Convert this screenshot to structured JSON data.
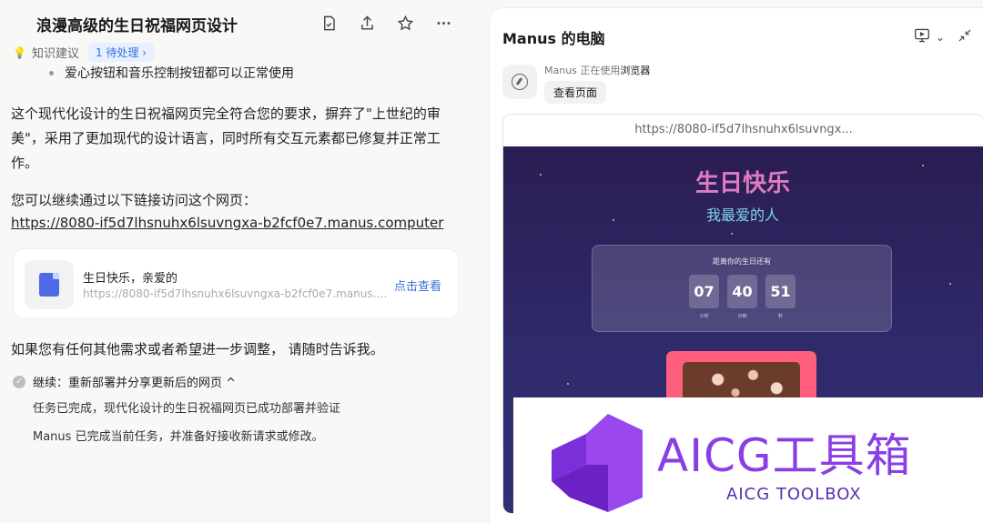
{
  "left": {
    "title": "浪漫高级的生日祝福网页设计",
    "knowledge": {
      "label": "知识建议",
      "badge": "1 待处理 ›"
    },
    "bullet": "爱心按钮和音乐控制按钮都可以正常使用",
    "para1": "这个现代化设计的生日祝福网页完全符合您的要求，摒弃了\"上世纪的审美\"，采用了更加现代的设计语言，同时所有交互元素都已修复并正常工作。",
    "para2": "您可以继续通过以下链接访问这个网页：",
    "link": "https://8080-if5d7lhsnuhx6lsuvngxa-b2fcf0e7.manus.computer",
    "card": {
      "title": "生日快乐，亲爱的",
      "url": "https://8080-if5d7lhsnuhx6lsuvngxa-b2fcf0e7.manus.computer",
      "action": "点击查看"
    },
    "para3": "如果您有任何其他需求或者希望进一步调整， 请随时告诉我。",
    "continue": {
      "label": "继续：重新部署并分享更新后的网页 ^"
    },
    "status1": "任务已完成，现代化设计的生日祝福网页已成功部署并验证",
    "status2": "Manus 已完成当前任务，并准备好接收新请求或修改。"
  },
  "right": {
    "title": "Manus 的电脑",
    "agent_status_prefix": "Manus 正在使用",
    "agent_status_app": "浏览器",
    "view_button": "查看页面",
    "url": "https://8080-if5d7lhsnuhx6lsuvngx...",
    "site": {
      "heading": "生日快乐",
      "subheading": "我最爱的人",
      "countdown_title": "距离你的生日还有",
      "countdown": [
        {
          "value": "07",
          "label": "小时"
        },
        {
          "value": "40",
          "label": "分钟"
        },
        {
          "value": "51",
          "label": "秒"
        }
      ]
    }
  },
  "watermark": {
    "title": "AICG工具箱",
    "subtitle": "AICG TOOLBOX"
  },
  "colors": {
    "accent": "#3b6fd6",
    "site_bg": "#2a1d52",
    "heading_pink": "#e07ac2",
    "watermark": "#8a3ee6"
  }
}
